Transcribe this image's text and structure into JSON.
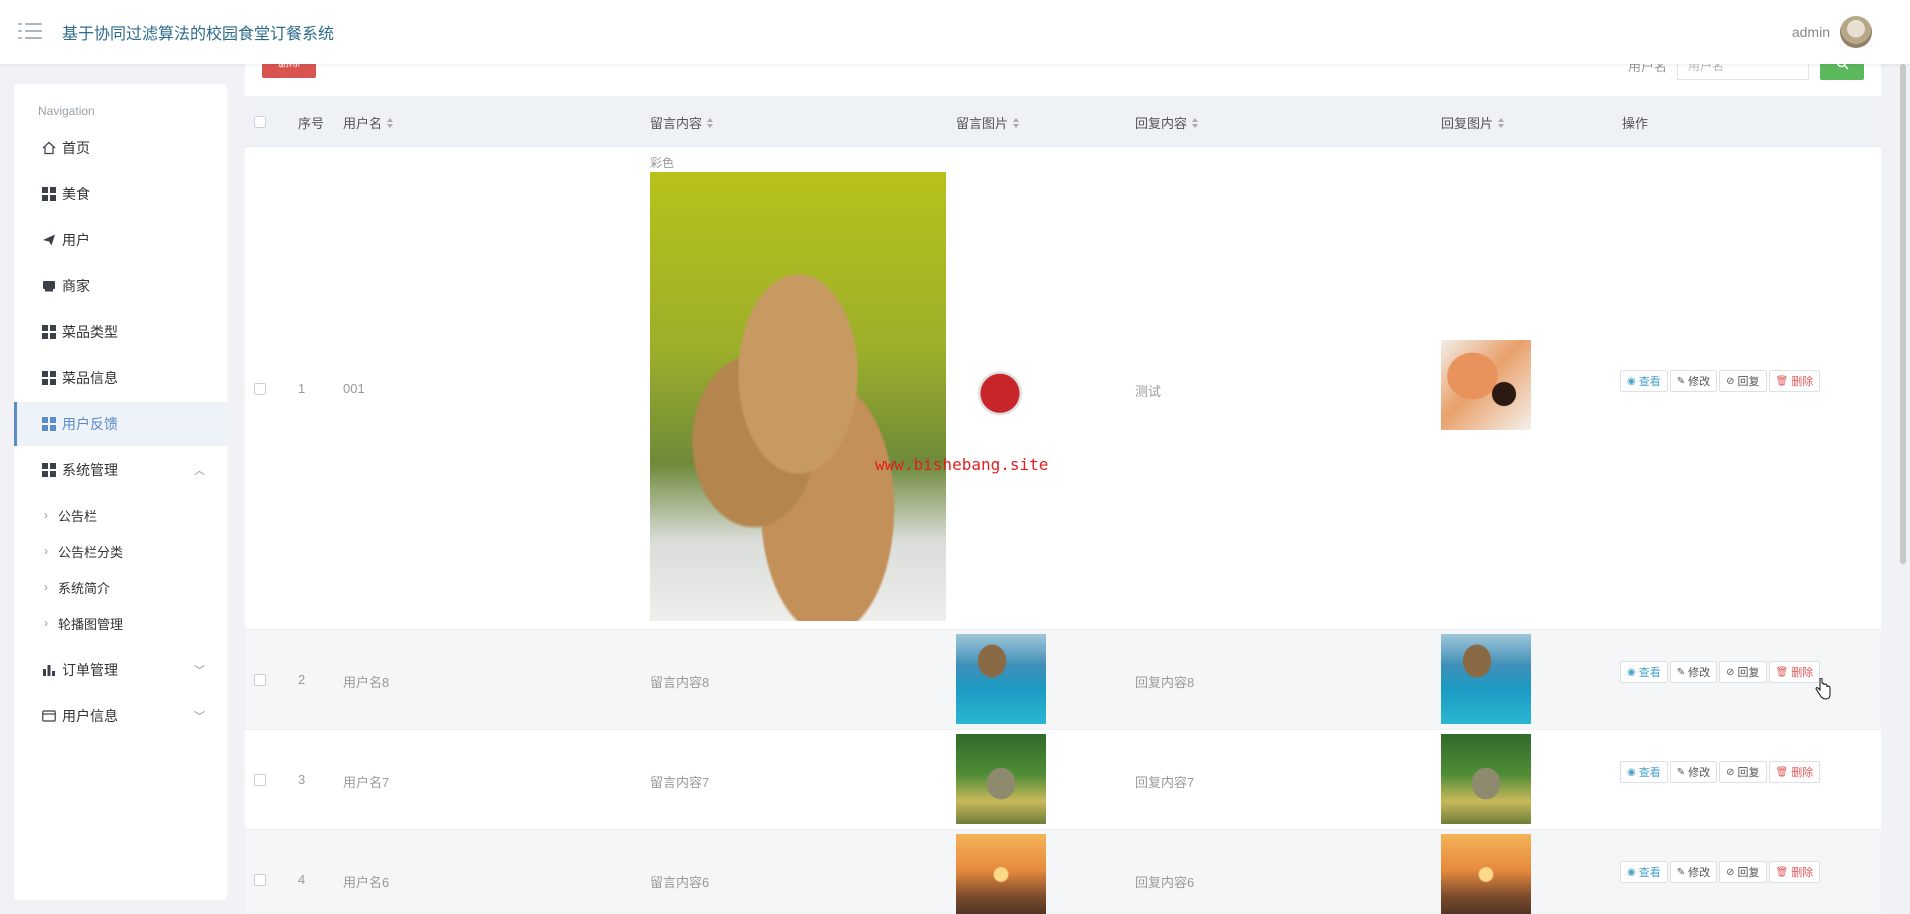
{
  "header": {
    "title": "基于协同过滤算法的校园食堂订餐系统",
    "user": "admin"
  },
  "sidebar": {
    "caption": "Navigation",
    "items": [
      {
        "label": "首页"
      },
      {
        "label": "美食"
      },
      {
        "label": "用户"
      },
      {
        "label": "商家"
      },
      {
        "label": "菜品类型"
      },
      {
        "label": "菜品信息"
      },
      {
        "label": "用户反馈"
      },
      {
        "label": "系统管理"
      },
      {
        "label": "订单管理"
      },
      {
        "label": "用户信息"
      }
    ],
    "system_sub": [
      {
        "label": "公告栏"
      },
      {
        "label": "公告栏分类"
      },
      {
        "label": "系统简介"
      },
      {
        "label": "轮播图管理"
      }
    ]
  },
  "toolbar": {
    "delete_label": "删除",
    "search_label": "用户名",
    "search_placeholder": "用户名"
  },
  "table": {
    "columns": [
      "序号",
      "用户名",
      "留言内容",
      "留言图片",
      "回复内容",
      "回复图片",
      "操作"
    ],
    "rows": [
      {
        "index": "1",
        "username": "001",
        "content": "彩色",
        "reply": "测试"
      },
      {
        "index": "2",
        "username": "用户名8",
        "content": "留言内容8",
        "reply": "回复内容8"
      },
      {
        "index": "3",
        "username": "用户名7",
        "content": "留言内容7",
        "reply": "回复内容7"
      },
      {
        "index": "4",
        "username": "用户名6",
        "content": "留言内容6",
        "reply": "回复内容6"
      }
    ],
    "actions": {
      "view": "查看",
      "edit": "修改",
      "reply": "回复",
      "delete": "删除"
    }
  },
  "watermark": "www.bishebang.site",
  "colors": {
    "accent": "#5b8ac5",
    "danger": "#d9534f",
    "success": "#5cb85c",
    "title": "#2d6b8a"
  }
}
